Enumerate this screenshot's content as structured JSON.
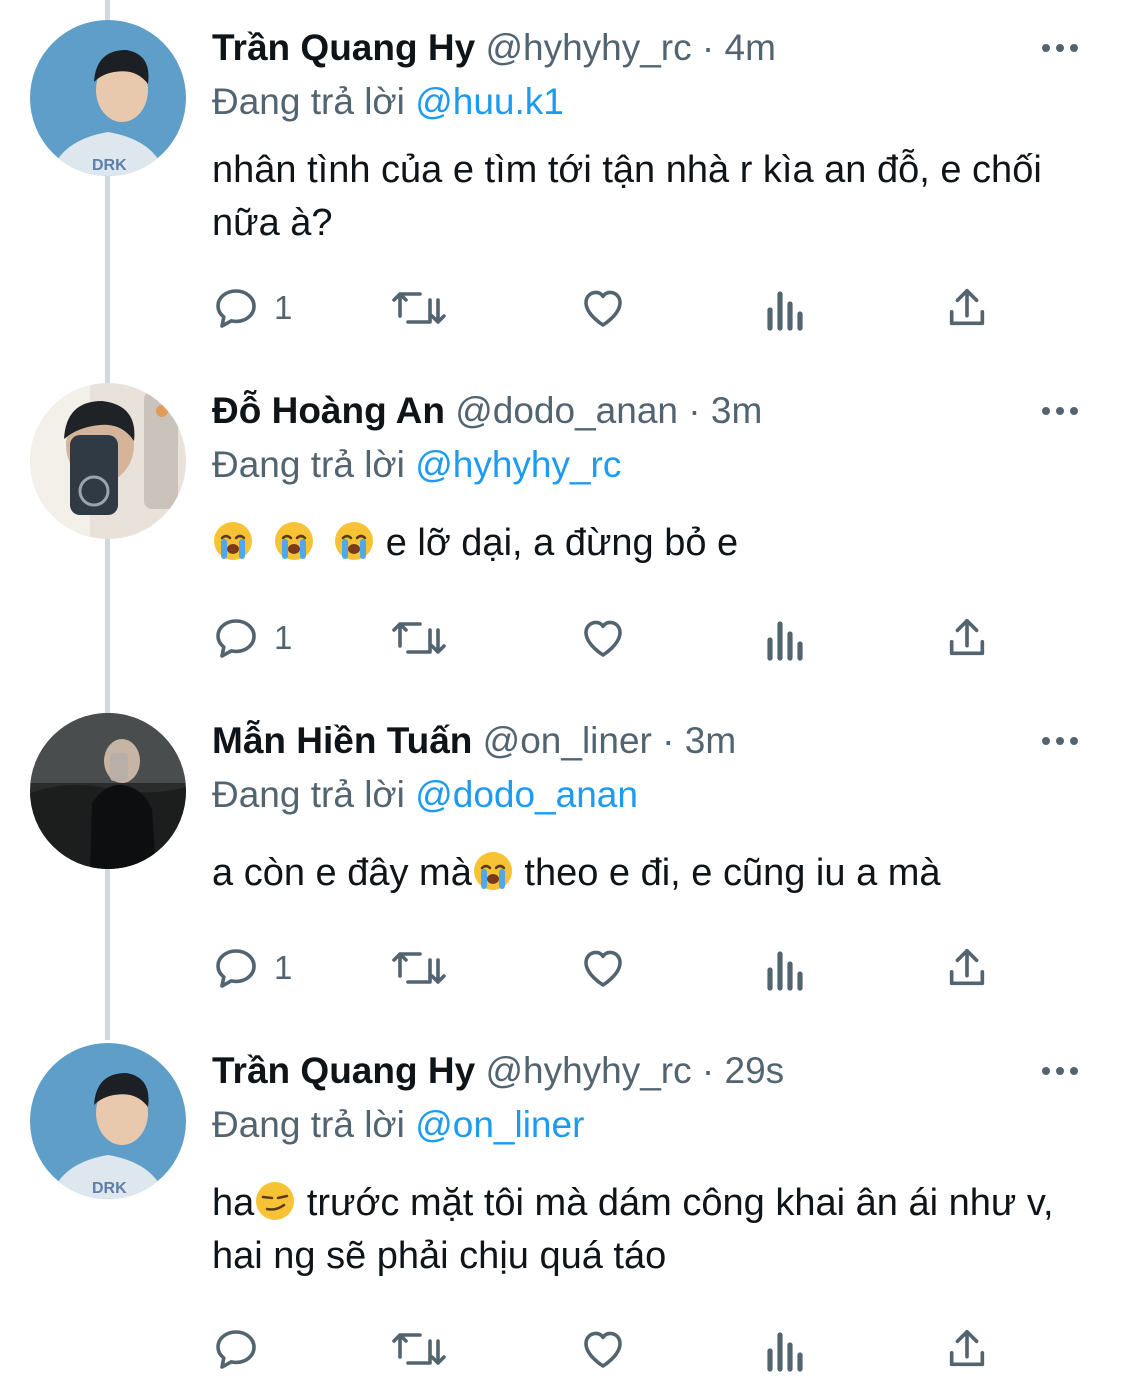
{
  "tweets": [
    {
      "name": "Trần Quang Hy",
      "handle": "@hyhyhy_rc",
      "separator": "·",
      "time": "4m",
      "replying_prefix": "Đang trả lời",
      "replying_to": "@huu.k1",
      "text_before": "nhân tình của e tìm tới tận nhà r kìa an đỗ, e chối nữa à?",
      "text_after": "",
      "emojis": [],
      "reply_count": "1"
    },
    {
      "name": "Đỗ Hoàng An",
      "handle": "@dodo_anan",
      "separator": "·",
      "time": "3m",
      "replying_prefix": "Đang trả lời",
      "replying_to": "@hyhyhy_rc",
      "text_before": "",
      "text_after": " e lỡ dại, a đừng bỏ e",
      "emojis": [
        "loudly-crying-face",
        "loudly-crying-face",
        "loudly-crying-face"
      ],
      "reply_count": "1"
    },
    {
      "name": "Mẫn Hiền Tuấn",
      "handle": "@on_liner",
      "separator": "·",
      "time": "3m",
      "replying_prefix": "Đang trả lời",
      "replying_to": "@dodo_anan",
      "text_before": "a còn e đây mà",
      "text_after": "  theo e đi, e cũng iu a mà",
      "emojis": [
        "loudly-crying-face"
      ],
      "reply_count": "1"
    },
    {
      "name": "Trần Quang Hy",
      "handle": "@hyhyhy_rc",
      "separator": "·",
      "time": "29s",
      "replying_prefix": "Đang trả lời",
      "replying_to": "@on_liner",
      "text_before": "ha",
      "text_after": "  trước mặt tôi mà dám công khai ân ái như v, hai ng sẽ phải chịu quá táo",
      "emojis": [
        "smirking-face"
      ],
      "reply_count": ""
    }
  ],
  "icons": {
    "reply": "reply-icon",
    "retweet": "retweet-icon",
    "like": "heart-icon",
    "views": "views-icon",
    "share": "share-icon",
    "more": "more-icon"
  },
  "colors": {
    "text": "#0f1419",
    "secondary": "#536471",
    "link": "#1d9bf0",
    "thread_line": "#cfd9de"
  }
}
